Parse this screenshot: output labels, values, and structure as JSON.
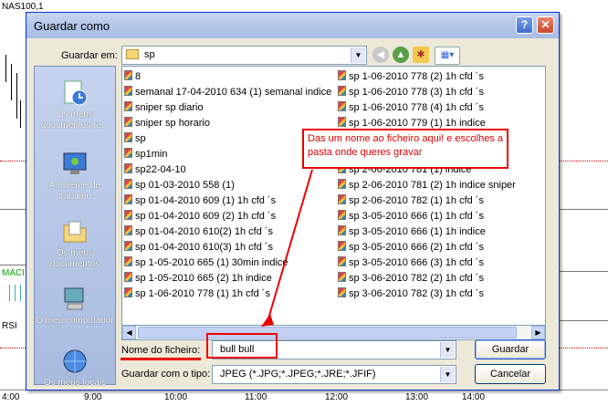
{
  "background": {
    "symbol": "NAS100,1",
    "indicator_macd": "MACI",
    "indicator_rsi": "RSI",
    "time_axis": [
      "9:00",
      "10:00",
      "11:00",
      "12:00",
      "13:00",
      "14:00"
    ],
    "axis_prefix": "4:00"
  },
  "dialog": {
    "title": "Guardar como",
    "help_label": "?",
    "close_label": "✕",
    "save_in_label": "Guardar em:",
    "save_in_value": "sp",
    "places": [
      {
        "label": "Os meus documentos re...",
        "icon": "recent-documents-icon"
      },
      {
        "label": "Ambiente de trabalho",
        "icon": "desktop-icon"
      },
      {
        "label": "Os meus documentos",
        "icon": "my-documents-icon"
      },
      {
        "label": "O meu computador",
        "icon": "my-computer-icon"
      },
      {
        "label": "Os meus locais",
        "icon": "network-places-icon"
      }
    ],
    "files_left": [
      "8",
      "semanal 17-04-2010 634 (1) semanal indice",
      "sniper sp diario",
      "sniper sp horario",
      "sp",
      "sp1min",
      "sp22-04-10",
      "sp 01-03-2010 558 (1)",
      "sp 01-04-2010 609 (1) 1h cfd ´s",
      "sp 01-04-2010 609 (2) 1h cfd ´s",
      "sp 01-04-2010 610(2) 1h cfd ´s",
      "sp 01-04-2010 610(3) 1h cfd ´s",
      "sp 1-05-2010 665 (1) 30min indice",
      "sp 1-05-2010 665 (2) 1h indice",
      "sp 1-06-2010 778 (1) 1h cfd ´s"
    ],
    "files_right": [
      "sp 1-06-2010 778 (2) 1h cfd ´s",
      "sp 1-06-2010 778 (3) 1h cfd ´s",
      "sp 1-06-2010 778 (4) 1h cfd ´s",
      "sp 1-06-2010 779 (1) 1h indice",
      "",
      "",
      "sp 2-06-2010 781 (1) indice",
      "sp 2-06-2010 781 (2) 1h indice sniper",
      "sp 2-06-2010 782 (1) 1h cfd ´s",
      "sp 3-05-2010 666 (1) 1h cfd ´s",
      "sp 3-05-2010 666 (1) 1h indice",
      "sp 3-05-2010 666 (2) 1h cfd ´s",
      "sp 3-05-2010 666 (3) 1h cfd ´s",
      "sp 3-06-2010 782 (2) 1h cfd ´s",
      "sp 3-06-2010 782 (3) 1h cfd ´s"
    ],
    "filename_label": "Nome do ficheiro:",
    "filename_value": "bull bull",
    "filetype_label": "Guardar com o tipo:",
    "filetype_value": "JPEG (*.JPG;*.JPEG;*.JRE;*.JFIF)",
    "save_button": "Guardar",
    "cancel_button": "Cancelar",
    "annotation": "Das um nome ao ficheiro aqui! e escolhes a pasta onde queres gravar",
    "accent_color": "#e00000"
  }
}
